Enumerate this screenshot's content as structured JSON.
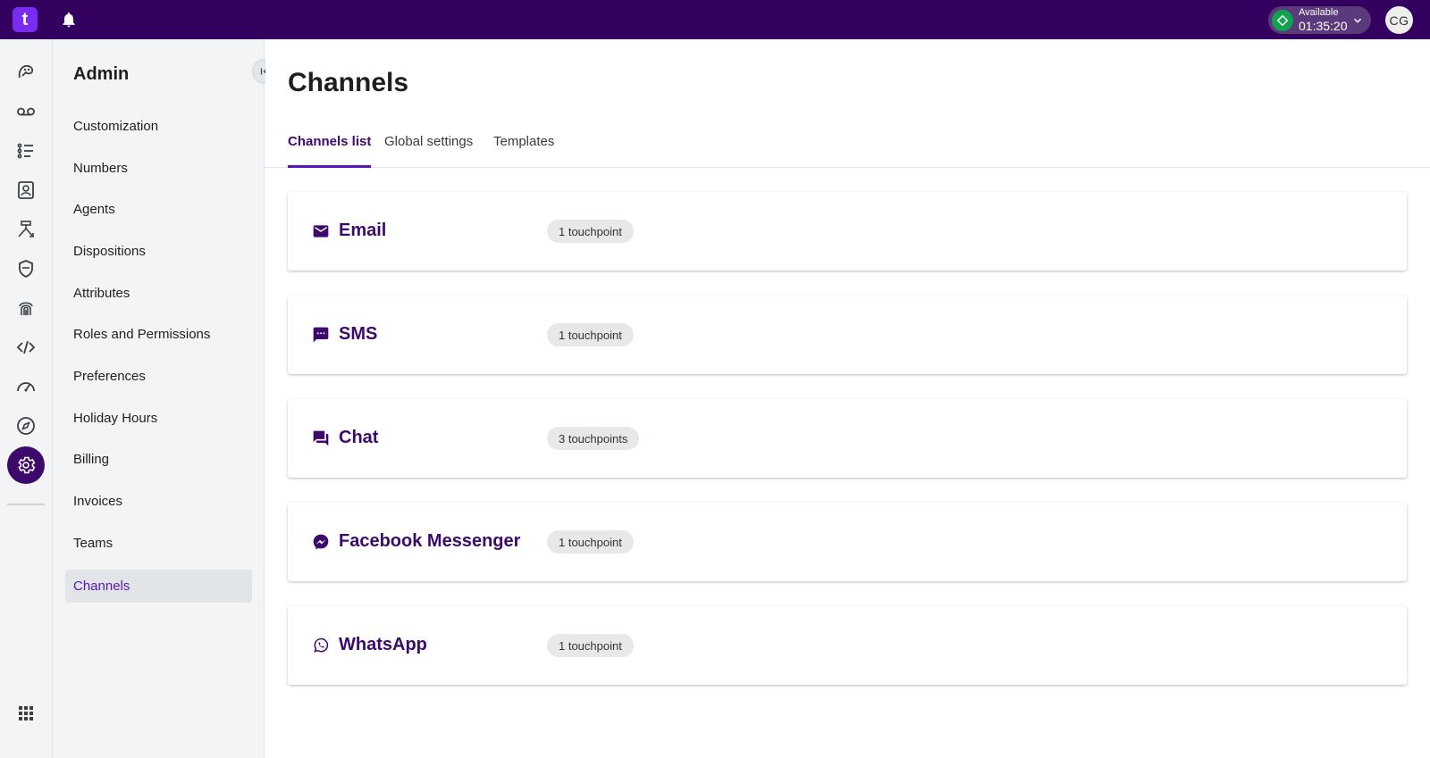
{
  "topbar": {
    "logo_letter": "t",
    "status": {
      "label": "Available",
      "time": "01:35:20",
      "color": "#10a24e"
    },
    "avatar_initials": "CG",
    "brand_color": "#34005f"
  },
  "rail": {
    "icons": [
      "conversations-icon",
      "voicemail-icon",
      "list-icon",
      "contacts-icon",
      "routing-icon",
      "shield-icon",
      "fingerprint-icon",
      "code-icon",
      "speedometer-icon",
      "compass-icon",
      "settings-icon",
      "apps-grid-icon"
    ],
    "active": "settings-icon"
  },
  "sidebar": {
    "title": "Admin",
    "items": [
      {
        "label": "Customization"
      },
      {
        "label": "Numbers"
      },
      {
        "label": "Agents"
      },
      {
        "label": "Dispositions"
      },
      {
        "label": "Attributes"
      },
      {
        "label": "Roles and Permissions"
      },
      {
        "label": "Preferences"
      },
      {
        "label": "Holiday Hours"
      },
      {
        "label": "Billing"
      },
      {
        "label": "Invoices"
      },
      {
        "label": "Teams"
      },
      {
        "label": "Channels"
      }
    ],
    "active_item": "Channels"
  },
  "main": {
    "title": "Channels",
    "tabs": [
      {
        "label": "Channels list"
      },
      {
        "label": "Global settings"
      },
      {
        "label": "Templates"
      }
    ],
    "active_tab": "Channels list",
    "channels": [
      {
        "name": "Email",
        "badge": "1 touchpoint",
        "icon": "email-icon"
      },
      {
        "name": "SMS",
        "badge": "1 touchpoint",
        "icon": "sms-icon"
      },
      {
        "name": "Chat",
        "badge": "3 touchpoints",
        "icon": "chat-icon"
      },
      {
        "name": "Facebook Messenger",
        "badge": "1 touchpoint",
        "icon": "messenger-icon"
      },
      {
        "name": "WhatsApp",
        "badge": "1 touchpoint",
        "icon": "whatsapp-icon"
      }
    ],
    "accent_color": "#3d0a6b"
  }
}
